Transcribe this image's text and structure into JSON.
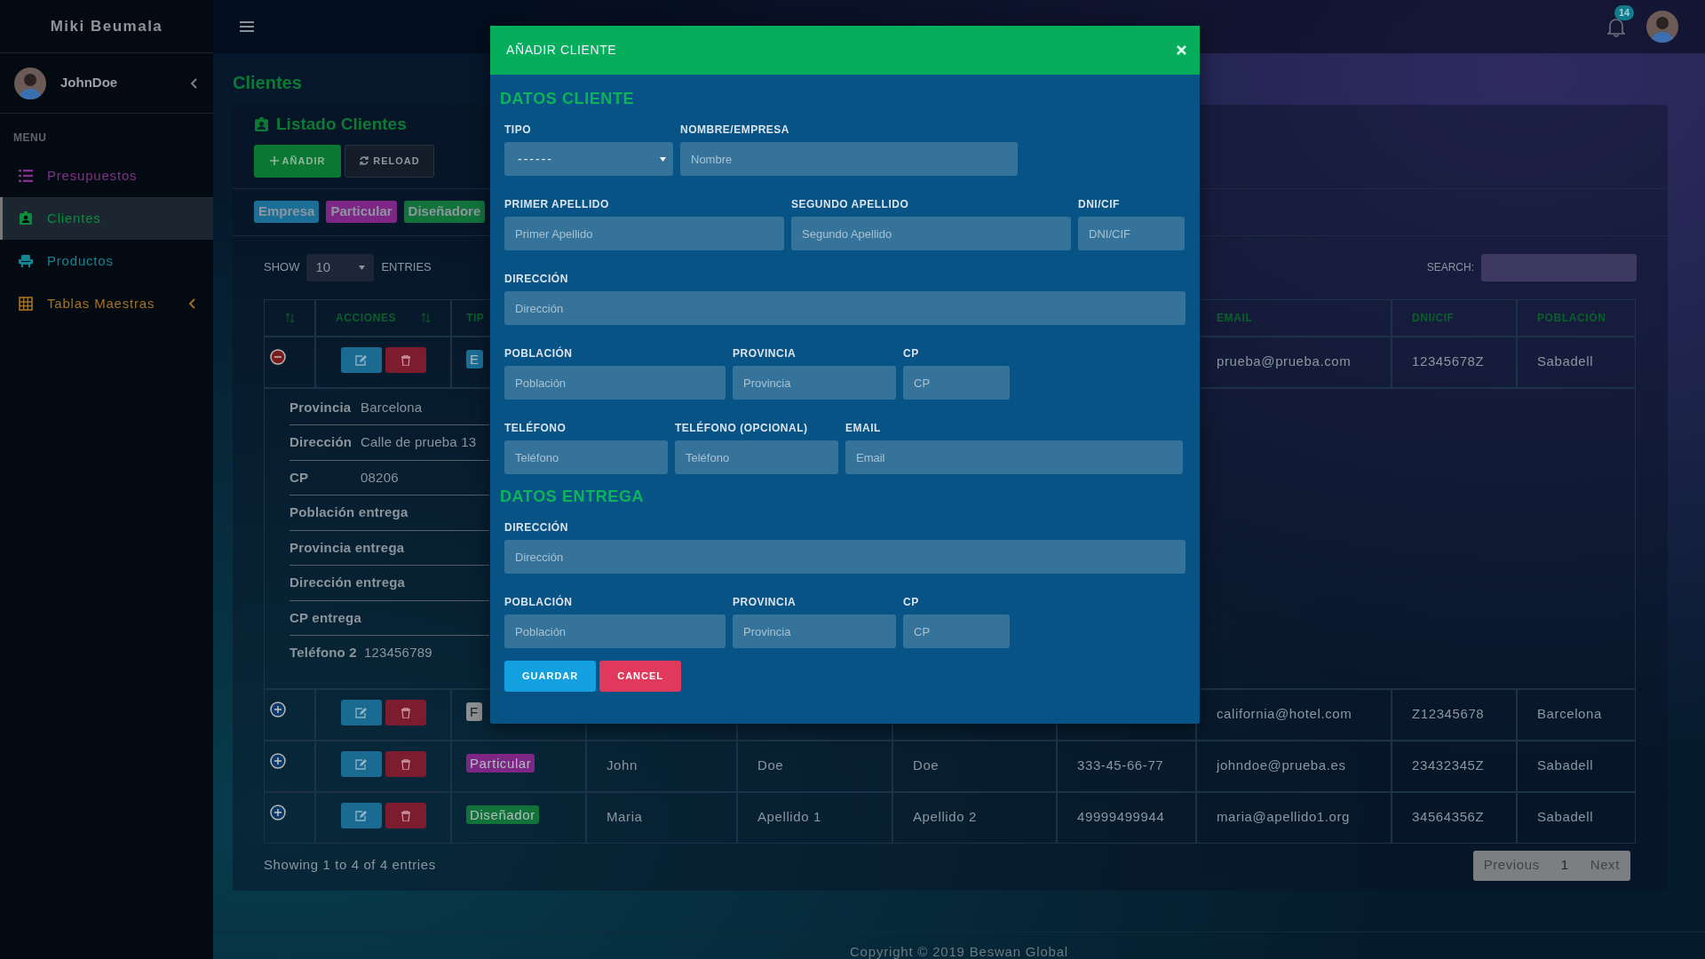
{
  "sidebar": {
    "brand": "Miki Beumala",
    "user": {
      "name": "JohnDoe"
    },
    "menu_heading": "MENU",
    "items": [
      {
        "label": "Presupuestos",
        "kind": "link",
        "color": "#82308a",
        "selected": false
      },
      {
        "label": "Clientes",
        "kind": "link",
        "color": "#0e8a3c",
        "selected": true
      },
      {
        "label": "Productos",
        "kind": "link",
        "color": "#148595",
        "selected": false
      },
      {
        "label": "Tablas Maestras",
        "kind": "group",
        "color": "#a8711c",
        "selected": false
      }
    ]
  },
  "topbar": {
    "notifications": "14"
  },
  "page_title": "Clientes",
  "card": {
    "title": "Listado Clientes",
    "buttons": [
      {
        "label": "AÑADIR",
        "kind": "add"
      },
      {
        "label": "RELOAD",
        "kind": "reload"
      }
    ],
    "tags": [
      {
        "label": "Empresa",
        "color": "#1b6f96"
      },
      {
        "label": "Particular",
        "color": "#7d2685"
      },
      {
        "label": "Diseñadore",
        "color": "#11733a"
      }
    ],
    "length": {
      "before": "SHOW",
      "value": "10",
      "after": "ENTRIES"
    },
    "search_label": "SEARCH:",
    "table": {
      "headers": {
        "acciones": "ACCIONES",
        "tipo": "TIP",
        "email": "EMAIL",
        "dni": "DNI/CIF",
        "poblacion": "POBLACIÓN"
      },
      "rows": [
        {
          "expanded": true,
          "tipo": {
            "label": "E",
            "color": "#1b6f96"
          },
          "email": "prueba@prueba.com",
          "dni": "12345678Z",
          "poblacion": "Sabadell",
          "details": [
            {
              "label": "Provincia",
              "value": "Barcelona"
            },
            {
              "label": "Dirección",
              "value": "Calle de prueba 13"
            },
            {
              "label": "CP",
              "value": "08206"
            },
            {
              "label": "Población entrega"
            },
            {
              "label": "Provincia entrega"
            },
            {
              "label": "Dirección entrega"
            },
            {
              "label": "CP entrega"
            },
            {
              "label": "Teléfono 2",
              "value": "123456789"
            }
          ]
        },
        {
          "expanded": false,
          "tipo": {
            "label": "F",
            "color": "#8d8f91"
          },
          "email": "california@hotel.com",
          "dni": "Z12345678",
          "poblacion": "Barcelona"
        },
        {
          "expanded": false,
          "tipo": {
            "label": "Particular",
            "color": "#7d2685"
          },
          "nombre": "John",
          "apellido1": "Doe",
          "apellido2": "Doe",
          "telefono": "333-45-66-77",
          "email": "johndoe@prueba.es",
          "dni": "23432345Z",
          "poblacion": "Sabadell"
        },
        {
          "expanded": false,
          "tipo": {
            "label": "Diseñador",
            "color": "#11733a"
          },
          "nombre": "Maria",
          "apellido1": "Apellido 1",
          "apellido2": "Apellido 2",
          "telefono": "49999499944",
          "email": "maria@apellido1.org",
          "dni": "34564356Z",
          "poblacion": "Sabadell"
        }
      ]
    },
    "info": "Showing 1 to 4 of 4 entries",
    "pagination": [
      {
        "label": "Previous",
        "selected": false
      },
      {
        "label": "1",
        "selected": true
      },
      {
        "label": "Next",
        "selected": false
      }
    ]
  },
  "footer": "Copyright © 2019 Beswan Global",
  "modal": {
    "title": "AÑADIR CLIENTE",
    "sections": [
      {
        "title": "DATOS CLIENTE",
        "rows": [
          [
            {
              "label": "TIPO",
              "kind": "select",
              "value": "------"
            },
            {
              "label": "NOMBRE/EMPRESA",
              "kind": "input",
              "placeholder": "Nombre"
            }
          ],
          [
            {
              "label": "PRIMER APELLIDO",
              "kind": "input",
              "placeholder": "Primer Apellido"
            },
            {
              "label": "SEGUNDO APELLIDO",
              "kind": "input",
              "placeholder": "Segundo Apellido"
            },
            {
              "label": "DNI/CIF",
              "kind": "input",
              "placeholder": "DNI/CIF"
            }
          ],
          [
            {
              "label": "DIRECCIÓN",
              "kind": "input",
              "placeholder": "Dirección"
            }
          ],
          [
            {
              "label": "POBLACIÓN",
              "kind": "input",
              "placeholder": "Población"
            },
            {
              "label": "PROVINCIA",
              "kind": "input",
              "placeholder": "Provincia"
            },
            {
              "label": "CP",
              "kind": "input",
              "placeholder": "CP"
            }
          ],
          [
            {
              "label": "TELÉFONO",
              "kind": "input",
              "placeholder": "Teléfono"
            },
            {
              "label": "TELÉFONO (OPCIONAL)",
              "kind": "input",
              "placeholder": "Teléfono"
            },
            {
              "label": "EMAIL",
              "kind": "input",
              "placeholder": "Email"
            }
          ]
        ]
      },
      {
        "title": "DATOS ENTREGA",
        "rows": [
          [
            {
              "label": "DIRECCIÓN",
              "kind": "input",
              "placeholder": "Dirección"
            }
          ],
          [
            {
              "label": "POBLACIÓN",
              "kind": "input",
              "placeholder": "Población"
            },
            {
              "label": "PROVINCIA",
              "kind": "input",
              "placeholder": "Provincia"
            },
            {
              "label": "CP",
              "kind": "input",
              "placeholder": "CP"
            }
          ]
        ]
      }
    ],
    "buttons": [
      {
        "label": "GUARDAR",
        "kind": "save"
      },
      {
        "label": "CANCEL",
        "kind": "cancel"
      }
    ]
  }
}
